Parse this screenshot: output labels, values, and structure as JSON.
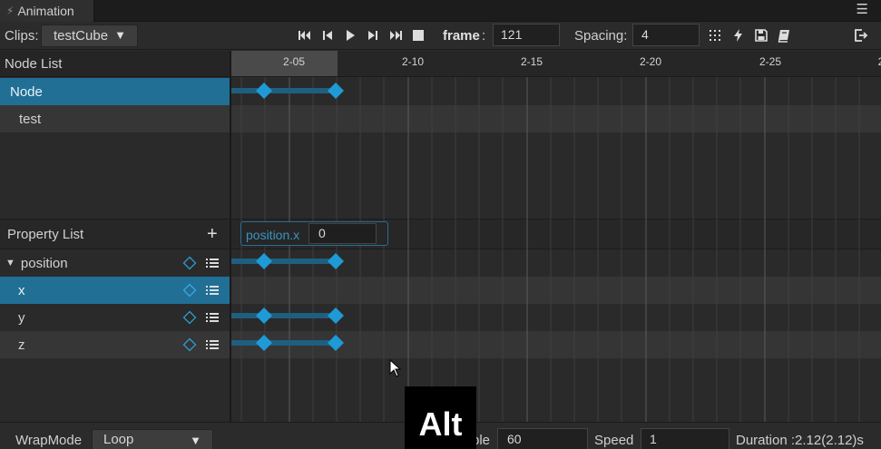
{
  "panel": {
    "tab_title": "Animation"
  },
  "toolbar": {
    "clips_label": "Clips:",
    "clip_selected": "testCube",
    "frame_label": "frame",
    "frame_colon": ":",
    "frame_value": "121",
    "spacing_label": "Spacing:",
    "spacing_value": "4"
  },
  "node_list": {
    "header": "Node List",
    "items": [
      {
        "label": "Node",
        "selected": true
      },
      {
        "label": "test",
        "selected": false
      }
    ]
  },
  "property_list": {
    "header": "Property List",
    "items": [
      {
        "label": "position",
        "expanded": true,
        "selected": false
      },
      {
        "label": "x",
        "selected": true
      },
      {
        "label": "y",
        "selected": false
      },
      {
        "label": "z",
        "selected": false
      }
    ]
  },
  "timeline": {
    "tick_labels": [
      "2-05",
      "2-10",
      "2-15",
      "2-20",
      "2-25",
      "2"
    ]
  },
  "property_editor": {
    "name": "position.x",
    "value": "0"
  },
  "footer": {
    "wrap_mode_label": "WrapMode",
    "wrap_mode_value": "Loop",
    "sample_label": "ple",
    "sample_value": "60",
    "speed_label": "Speed",
    "speed_value": "1",
    "duration_text": "Duration :2.12(2.12)s"
  },
  "overlay": {
    "key_hint": "Alt"
  },
  "colors": {
    "accent": "#216f95",
    "keyframe": "#1e9ad6",
    "keyframe_bar": "#1e5f80"
  }
}
